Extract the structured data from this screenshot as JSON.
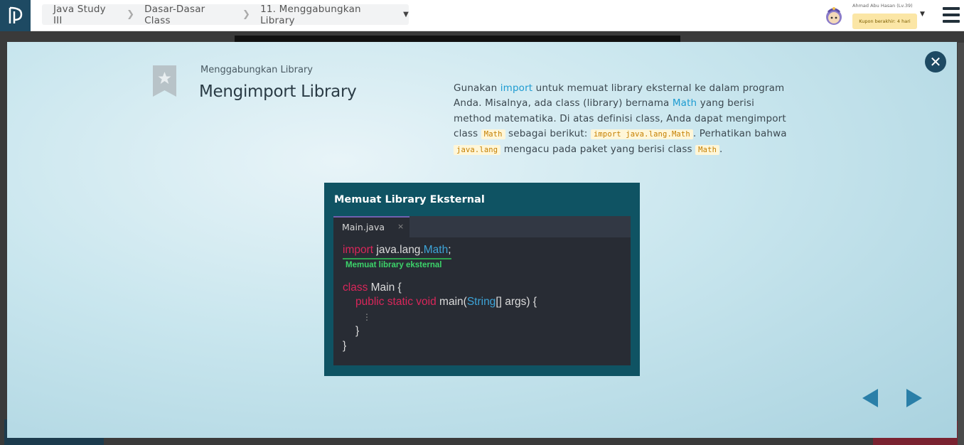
{
  "breadcrumb": {
    "course": "Java Study III",
    "chapter": "Dasar-Dasar Class",
    "lesson": "11. Menggabungkan Library"
  },
  "user": {
    "name": "Ahmad Abu Hasan (Lv.39)",
    "coupon": "Kupon berakhir: 4 hari"
  },
  "slide": {
    "section": "Menggabungkan Library",
    "title": "Mengimport Library",
    "desc": {
      "p1": "Gunakan ",
      "kw_import": "import",
      "p2": " untuk memuat library eksternal ke dalam program Anda. Misalnya, ada class (library) bernama ",
      "kw_math": "Math",
      "p3": " yang berisi method matematika. Di atas definisi class, Anda dapat mengimport class ",
      "chip1": "Math",
      "p4": " sebagai berikut: ",
      "chip2": "import java.lang.Math",
      "p5": ". Perhatikan bahwa ",
      "chip3": "java.lang",
      "p6": " mengacu pada paket yang berisi class ",
      "chip4": "Math",
      "p7": "."
    }
  },
  "figure": {
    "title": "Memuat Library Eksternal",
    "tab_name": "Main.java",
    "tab_close": "×",
    "annotation": "Memuat library eksternal",
    "code": {
      "l1_kw": "import",
      "l1_pkg": " java.lang.",
      "l1_cls": "Math",
      "l1_end": ";",
      "l2_kw": "class",
      "l2_rest": " Main {",
      "l3_kw": "public static void",
      "l3_name": " main(",
      "l3_type": "String",
      "l3_rest": "[] args) {",
      "l4": "⋮",
      "l5": "}",
      "l6": "}"
    }
  },
  "colors": {
    "accent": "#1d9bd1",
    "figure_bg": "#0f5363",
    "nav_dark": "#1e4a63",
    "keyword_red": "#d9265a",
    "code_green": "#3cd46a"
  }
}
